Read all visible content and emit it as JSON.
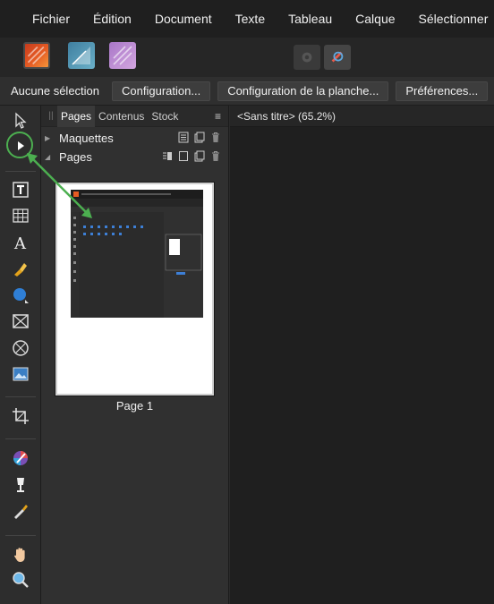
{
  "menu": {
    "items": [
      "Fichier",
      "Édition",
      "Document",
      "Texte",
      "Tableau",
      "Calque",
      "Sélectionner"
    ]
  },
  "context": {
    "selection_label": "Aucune sélection",
    "buttons": [
      "Configuration...",
      "Configuration de la planche...",
      "Préférences..."
    ]
  },
  "panel": {
    "tabs": [
      "Pages",
      "Contenus",
      "Stock"
    ],
    "active_tab": "Pages",
    "sections": [
      "Maquettes",
      "Pages"
    ],
    "page_label": "Page 1"
  },
  "document": {
    "tab_title": "<Sans titre> (65.2%)"
  },
  "colors": {
    "highlight": "#4caf50",
    "accent": "#e65c24"
  }
}
